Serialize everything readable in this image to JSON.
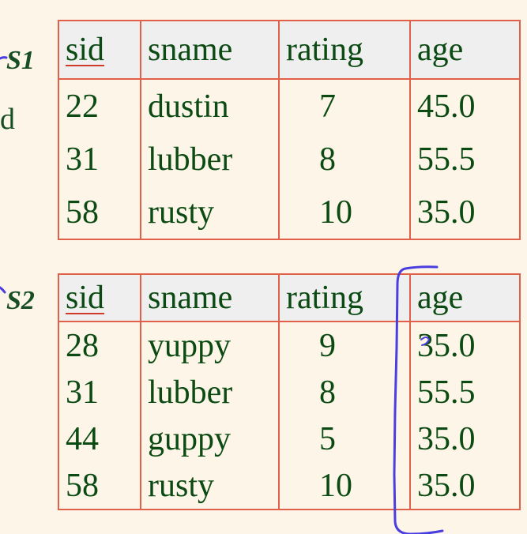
{
  "side_labels": {
    "s1": "S1",
    "s2": "S2",
    "cut_letter": "d"
  },
  "table_s1": {
    "headers": [
      "sid",
      "sname",
      "rating",
      "age"
    ],
    "rows": [
      [
        "22",
        "dustin",
        "7",
        "45.0"
      ],
      [
        "31",
        "lubber",
        "8",
        "55.5"
      ],
      [
        "58",
        "rusty",
        "10",
        "35.0"
      ]
    ]
  },
  "table_s2": {
    "headers": [
      "sid",
      "sname",
      "rating",
      "age"
    ],
    "rows": [
      [
        "28",
        "yuppy",
        "9",
        "35.0"
      ],
      [
        "31",
        "lubber",
        "8",
        "55.5"
      ],
      [
        "44",
        "guppy",
        "5",
        "35.0"
      ],
      [
        "58",
        "rusty",
        "10",
        "35.0"
      ]
    ]
  },
  "colors": {
    "background": "#fdf6e8",
    "text": "#0b4a12",
    "table_border": "#e0604a",
    "header_fill": "#efefef",
    "key_underline": "#d13a2a",
    "annotation_ink": "#4a3ee0"
  }
}
